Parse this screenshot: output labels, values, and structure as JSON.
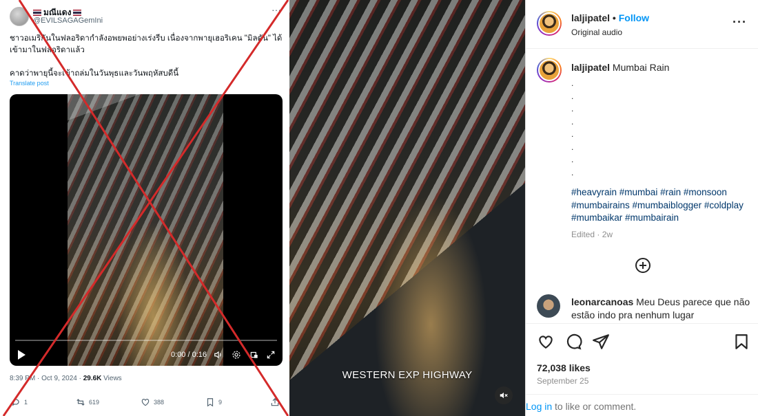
{
  "tweet": {
    "display_name": "มณีแดง",
    "handle": "@EVILSAGAGemIni",
    "more": "···",
    "text_line1": "ชาวอเมริกันในฟลอริดากำลังอพยพอย่างเร่งรีบ เนื่องจากพายุเฮอริเคน \"มิลตัน\" ได้เข้ามาในฟลอริดาแล้ว",
    "text_line2": "คาดว่าพายุนี้จะเข้าถล่มในวันพุธและวันพฤหัสบดีนี้",
    "translate": "Translate post",
    "video_time": "0:00 / 0:16",
    "timestamp": "8:39 PM · Oct 9, 2024 · ",
    "views_count": "29.6K",
    "views_label": " Views",
    "replies": "1",
    "reposts": "619",
    "likes": "388",
    "bookmarks": "9"
  },
  "reel": {
    "caption": "WESTERN EXP HIGHWAY"
  },
  "instagram": {
    "username": "laljipatel",
    "separator": "•",
    "follow_label": "Follow",
    "audio": "Original audio",
    "more": "···",
    "caption_user": "laljipatel",
    "caption_text": " Mumbai Rain",
    "caption_dots": [
      ".",
      ".",
      ".",
      ".",
      ".",
      ".",
      ".",
      "."
    ],
    "hashtags": "#heavyrain #mumbai #rain #monsoon #mumbairains #mumbaiblogger #coldplay #mumbaikar #mumbairain",
    "edited": "Edited · 2w",
    "comment_user": "leonarcanoas",
    "comment_text": " Meu Deus parece que não estão indo pra nenhum lugar",
    "likes": "72,038 likes",
    "date": "September 25",
    "login_link": "Log in",
    "login_text": " to like or comment."
  },
  "colors": {
    "cross": "#d42a2a",
    "twitter_blue": "#1d9bf0",
    "ig_blue": "#0095f6",
    "ig_hashtag": "#00376b"
  },
  "icons": [
    "dots-icon",
    "play-icon",
    "volume-icon",
    "settings-icon",
    "pip-icon",
    "fullscreen-icon",
    "reply-icon",
    "repost-icon",
    "like-icon",
    "bookmark-icon",
    "share-icon",
    "mute-icon",
    "plus-circle-icon",
    "heart-icon",
    "comment-icon",
    "send-icon",
    "save-icon"
  ]
}
